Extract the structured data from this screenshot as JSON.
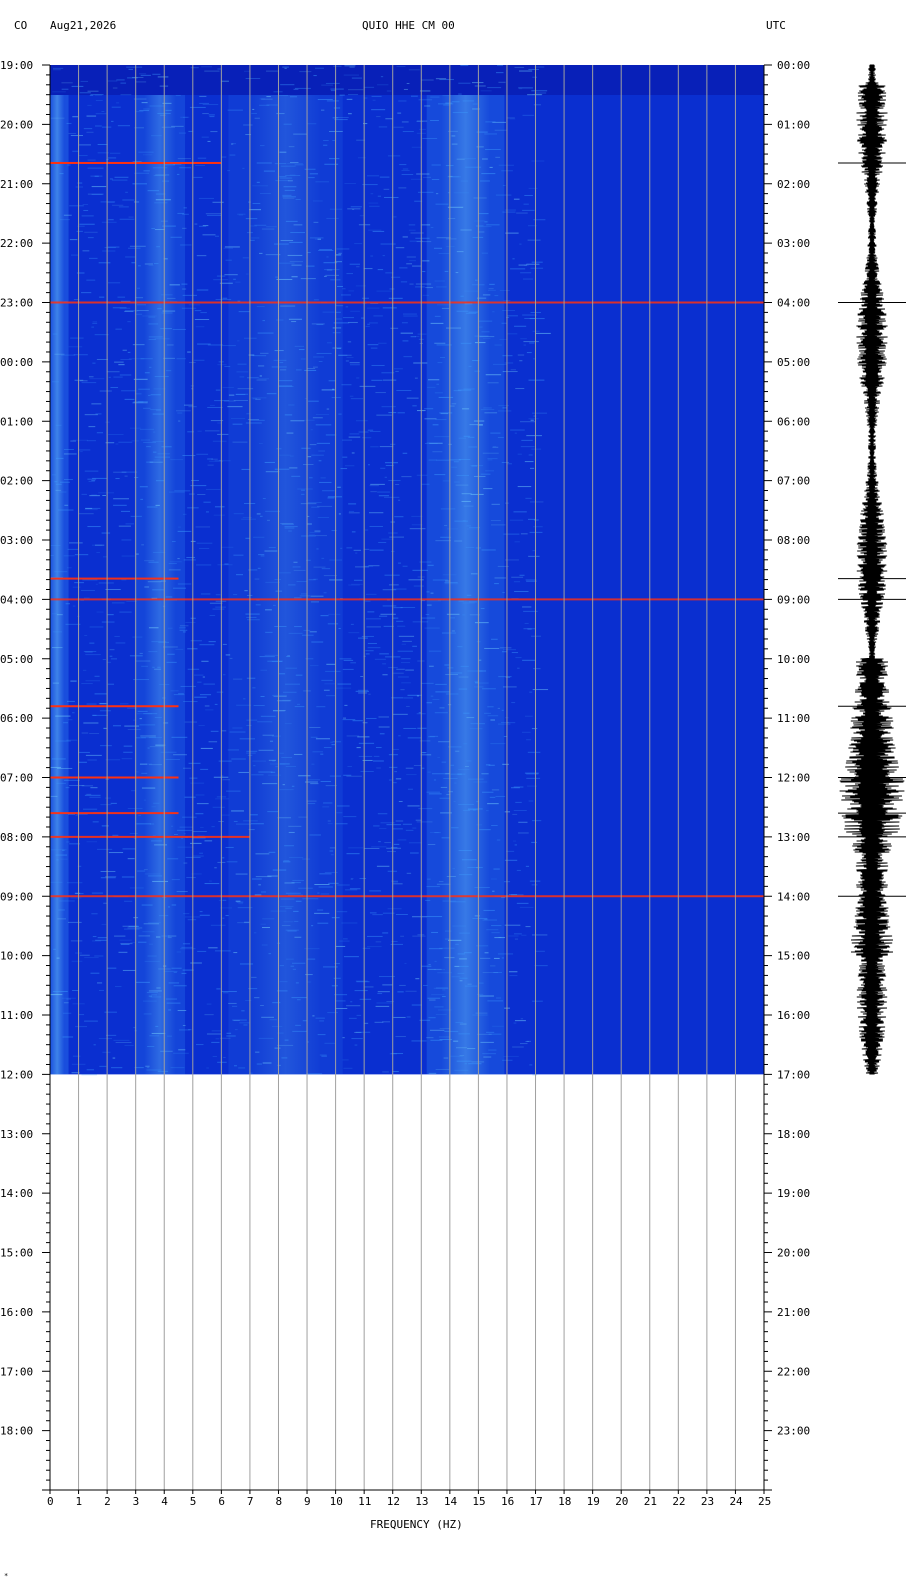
{
  "header": {
    "network": "CO",
    "date": "Aug21,2026",
    "station": "QUIO HHE CM 00",
    "timezone_right": "UTC"
  },
  "colors": {
    "background_blue": "#0a2fd0",
    "energy_light": "#3fa0ff",
    "energy_cyan": "#7fe0ff",
    "energy_hot": "#ff3010",
    "grid": "#a0a0a0",
    "axis": "#000000"
  },
  "chart_data": {
    "type": "heatmap",
    "title": "QUIO HHE CM 00",
    "xlabel": "FREQUENCY (HZ)",
    "xlim": [
      0,
      25
    ],
    "x_ticks": [
      "0",
      "1",
      "2",
      "3",
      "4",
      "5",
      "6",
      "7",
      "8",
      "9",
      "10",
      "11",
      "12",
      "13",
      "14",
      "15",
      "16",
      "17",
      "18",
      "19",
      "20",
      "21",
      "22",
      "23",
      "24",
      "25"
    ],
    "left_time_labels": [
      "19:00",
      "20:00",
      "21:00",
      "22:00",
      "23:00",
      "00:00",
      "01:00",
      "02:00",
      "03:00",
      "04:00",
      "05:00",
      "06:00",
      "07:00",
      "08:00",
      "09:00",
      "10:00",
      "11:00",
      "12:00",
      "13:00",
      "14:00",
      "15:00",
      "16:00",
      "17:00",
      "18:00"
    ],
    "right_time_labels": [
      "00:00",
      "01:00",
      "02:00",
      "03:00",
      "04:00",
      "05:00",
      "06:00",
      "07:00",
      "08:00",
      "09:00",
      "10:00",
      "11:00",
      "12:00",
      "13:00",
      "14:00",
      "15:00",
      "16:00",
      "17:00",
      "18:00",
      "19:00",
      "20:00",
      "21:00",
      "22:00",
      "23:00"
    ],
    "hours_total": 24,
    "data_hours": 17,
    "energy_bands": [
      {
        "f_low": 0,
        "f_high": 0.5,
        "intensity": 0.8
      },
      {
        "f_low": 3.3,
        "f_high": 4.4,
        "intensity": 0.55
      },
      {
        "f_low": 7,
        "f_high": 9.5,
        "intensity": 0.35
      },
      {
        "f_low": 13.7,
        "f_high": 15.4,
        "intensity": 0.7
      }
    ],
    "events": [
      {
        "hour": 1.65,
        "f_max": 6,
        "intensity": 1.0
      },
      {
        "hour": 4.0,
        "f_max": 25,
        "intensity": 0.7
      },
      {
        "hour": 8.65,
        "f_max": 4.5,
        "intensity": 0.9
      },
      {
        "hour": 9.0,
        "f_max": 25,
        "intensity": 0.6
      },
      {
        "hour": 10.8,
        "f_max": 4.5,
        "intensity": 1.0
      },
      {
        "hour": 12.0,
        "f_max": 4.5,
        "intensity": 1.0
      },
      {
        "hour": 12.6,
        "f_max": 4.5,
        "intensity": 0.9
      },
      {
        "hour": 13.0,
        "f_max": 7,
        "intensity": 0.8
      },
      {
        "hour": 14.0,
        "f_max": 25,
        "intensity": 0.7
      }
    ]
  }
}
